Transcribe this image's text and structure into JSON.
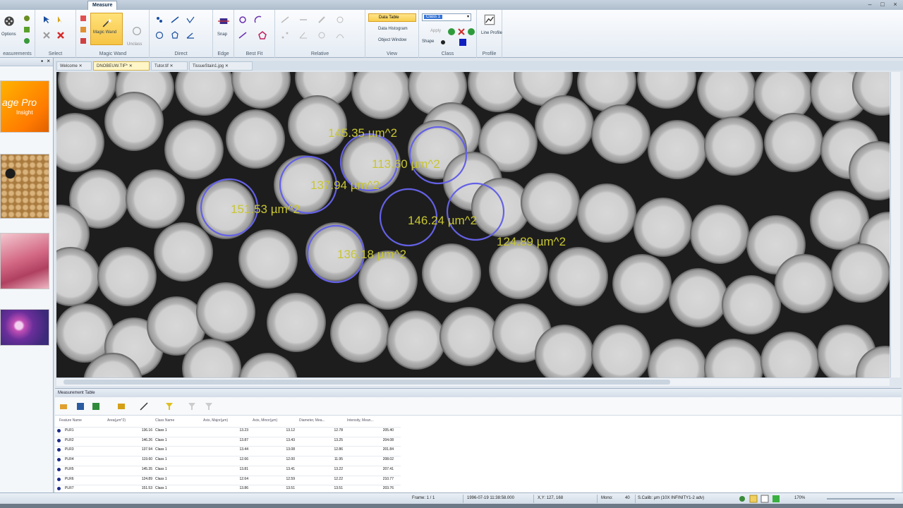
{
  "title_bar": {
    "active_tab": "Measure"
  },
  "ribbon": {
    "groups": [
      {
        "label": "easurements"
      },
      {
        "label": "Select"
      },
      {
        "label": "Magic Wand"
      },
      {
        "label": "Direct"
      },
      {
        "label": "Edge"
      },
      {
        "label": "Best Fit"
      },
      {
        "label": "Relative"
      },
      {
        "label": "View"
      },
      {
        "label": "Class"
      },
      {
        "label": "Profile"
      }
    ],
    "options_label": "Options",
    "magic_wand_label": "Magic Wand",
    "unclass_label": "Unclass",
    "snap_label": "Snap",
    "data_table_label": "Data Table",
    "data_histogram_label": "Data Histogram",
    "object_window_label": "Object Window",
    "class_selected": "Class 1",
    "apply_label": "Apply",
    "shape_label": "Shape",
    "line_profile_label": "Line Profile"
  },
  "thumbnails": {
    "logo_line1": "age Pro",
    "logo_line2": "Insight"
  },
  "doc_tabs": [
    "Welcome",
    "DNOBEUW.TIF*",
    "Tutor.tif",
    "TissueStain1.jpg"
  ],
  "image": {
    "annotations": [
      {
        "label": "145.35 µm^2"
      },
      {
        "label": "113.60 µm^2"
      },
      {
        "label": "137.94 µm^2"
      },
      {
        "label": "151.53 µm^2"
      },
      {
        "label": "146.24 µm^2"
      },
      {
        "label": "124.89 µm^2"
      },
      {
        "label": "136.18 µm^2"
      }
    ]
  },
  "measurement_table": {
    "title": "Measurement Table",
    "columns": [
      "Feature Name",
      "Area(µm^2)",
      "Class Name",
      "Axis, Major(µm)",
      "Axis, Minor(µm)",
      "Diameter, Mea...",
      "Intensity, Mean..."
    ],
    "rows": [
      [
        "PLR1",
        "136.16",
        "Class 1",
        "13.23",
        "13.12",
        "12.78",
        "205.40"
      ],
      [
        "PLR2",
        "146.26",
        "Class 1",
        "13.87",
        "13.43",
        "13.25",
        "204.08"
      ],
      [
        "PLR3",
        "137.94",
        "Class 1",
        "13.44",
        "13.08",
        "12.86",
        "201.84"
      ],
      [
        "PLR4",
        "119.60",
        "Class 1",
        "12.66",
        "12.00",
        "11.95",
        "208.02"
      ],
      [
        "PLR5",
        "145.35",
        "Class 1",
        "13.81",
        "13.41",
        "13.22",
        "207.41"
      ],
      [
        "PLR6",
        "124.89",
        "Class 1",
        "12.64",
        "12.59",
        "12.22",
        "210.77"
      ],
      [
        "PLR7",
        "151.53",
        "Class 1",
        "13.86",
        "13.51",
        "13.51",
        "203.76"
      ]
    ]
  },
  "status_bar": {
    "frame": "Frame: 1 / 1",
    "date": "1996-07-19 11:38:58.000",
    "xy": "X,Y: 127, 168",
    "mono_label": "Mono:",
    "mono_value": "40",
    "calibration": "S.Calib: µm (10X INFINITY1-2 adv)",
    "zoom": "170%"
  },
  "colors": {
    "annotation_text": "#c8c632",
    "outline": "#6461e6",
    "ribbon_accent": "#f6c445"
  }
}
